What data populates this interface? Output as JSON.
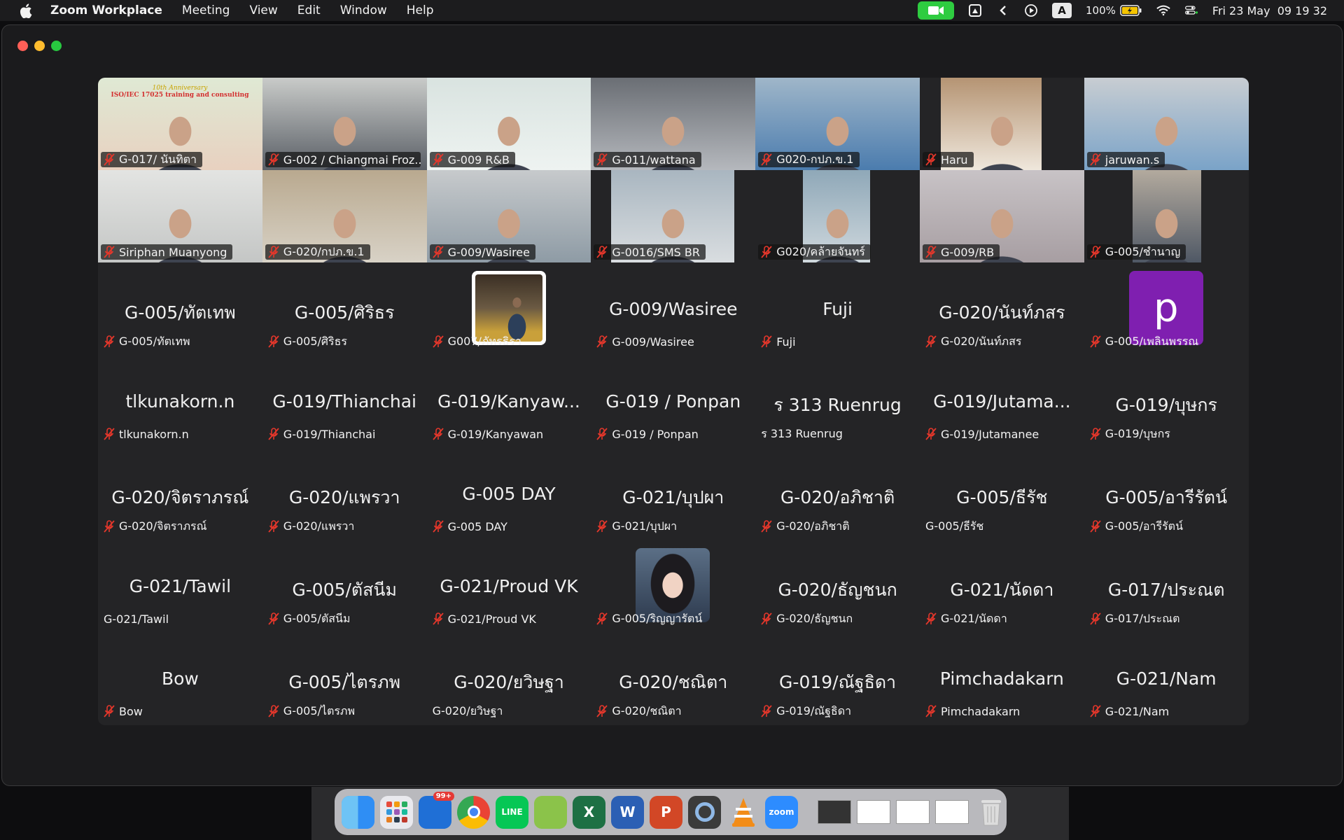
{
  "menubar": {
    "app_name": "Zoom Workplace",
    "items": [
      "Meeting",
      "View",
      "Edit",
      "Window",
      "Help"
    ],
    "keyboard_input": "A",
    "battery": "100%",
    "datetime": "Fri 23 May  09 19 32"
  },
  "gallery": {
    "video_tiles": [
      {
        "label": "G-017/ นันทิตา",
        "muted": true
      },
      {
        "label": "G-002 / Chiangmai Froz...",
        "muted": true
      },
      {
        "label": "G-009 R&B",
        "muted": true
      },
      {
        "label": "G-011/wattana",
        "muted": true
      },
      {
        "label": "G020-กปภ.ข.1",
        "muted": true
      },
      {
        "label": "Haru",
        "muted": true
      },
      {
        "label": "jaruwan.s",
        "muted": true
      },
      {
        "label": "Siriphan Muanyong",
        "muted": true
      },
      {
        "label": "G-020/กปภ.ข.1",
        "muted": true
      },
      {
        "label": "G-009/Wasiree",
        "muted": true
      },
      {
        "label": "G-0016/SMS BR",
        "muted": true
      },
      {
        "label": "G020/คล้ายจันทร์",
        "muted": true
      },
      {
        "label": "G-009/RB",
        "muted": true
      },
      {
        "label": "G-005/ชำนาญ",
        "muted": true
      }
    ],
    "video_banner": {
      "line1": "10th Anniversary",
      "line2": "ISO/IEC 17025 training and consulting"
    },
    "audio_rows": [
      [
        {
          "display": "G-005/ทัตเทพ",
          "label": "G-005/ทัตเทพ",
          "muted": true
        },
        {
          "display": "G-005/ศิริธร",
          "label": "G-005/ศิริธร",
          "muted": true
        },
        {
          "display": "",
          "label": "G007/ภัทรธิรา",
          "muted": true,
          "avatar": "photo"
        },
        {
          "display": "G-009/Wasiree",
          "label": "G-009/Wasiree",
          "muted": true
        },
        {
          "display": "Fuji",
          "label": "Fuji",
          "muted": true
        },
        {
          "display": "G-020/นันท์ภสร",
          "label": "G-020/นันท์ภสร",
          "muted": true
        },
        {
          "display": "",
          "label": "G-005/เพลินพรรณ",
          "muted": true,
          "avatar": "letter",
          "letter": "p"
        }
      ],
      [
        {
          "display": "tlkunakorn.n",
          "label": "tlkunakorn.n",
          "muted": true
        },
        {
          "display": "G-019/Thianchai",
          "label": "G-019/Thianchai",
          "muted": true
        },
        {
          "display": "G-019/Kanyaw...",
          "label": "G-019/Kanyawan",
          "muted": true
        },
        {
          "display": "G-019 / Ponpan",
          "label": "G-019 / Ponpan",
          "muted": true
        },
        {
          "display": "ร 313 Ruenrug",
          "label": "ร 313 Ruenrug",
          "muted": false
        },
        {
          "display": "G-019/Jutama...",
          "label": "G-019/Jutamanee",
          "muted": true
        },
        {
          "display": "G-019/บุษกร",
          "label": "G-019/บุษกร",
          "muted": true
        }
      ],
      [
        {
          "display": "G-020/จิตราภรณ์",
          "label": "G-020/จิตราภรณ์",
          "muted": true
        },
        {
          "display": "G-020/แพรวา",
          "label": "G-020/แพรวา",
          "muted": true
        },
        {
          "display": "G-005 DAY",
          "label": "G-005 DAY",
          "muted": true
        },
        {
          "display": "G-021/บุปผา",
          "label": "G-021/บุปผา",
          "muted": true
        },
        {
          "display": "G-020/อภิชาติ",
          "label": "G-020/อภิชาติ",
          "muted": true
        },
        {
          "display": "G-005/ธีรัช",
          "label": "G-005/ธีรัช",
          "muted": false
        },
        {
          "display": "G-005/อารีรัตน์",
          "label": "G-005/อารีรัตน์",
          "muted": true
        }
      ],
      [
        {
          "display": "G-021/Tawil",
          "label": "G-021/Tawil",
          "muted": false
        },
        {
          "display": "G-005/ตัสนีม",
          "label": "G-005/ตัสนีม",
          "muted": true
        },
        {
          "display": "G-021/Proud VK",
          "label": "G-021/Proud VK",
          "muted": true
        },
        {
          "display": "",
          "label": "G-005/ริญญารัตน์",
          "muted": true,
          "avatar": "photo2"
        },
        {
          "display": "G-020/ธัญชนก",
          "label": "G-020/ธัญชนก",
          "muted": true
        },
        {
          "display": "G-021/นัดดา",
          "label": "G-021/นัดดา",
          "muted": true
        },
        {
          "display": "G-017/ประณต",
          "label": "G-017/ประณต",
          "muted": true
        }
      ],
      [
        {
          "display": "Bow",
          "label": "Bow",
          "muted": true
        },
        {
          "display": "G-005/ไตรภพ",
          "label": "G-005/ไตรภพ",
          "muted": true
        },
        {
          "display": "G-020/ยวิษฐา",
          "label": "G-020/ยวิษฐา",
          "muted": false
        },
        {
          "display": "G-020/ชณิตา",
          "label": "G-020/ชณิตา",
          "muted": true
        },
        {
          "display": "G-019/ณัฐธิดา",
          "label": "G-019/ณัฐธิดา",
          "muted": true
        },
        {
          "display": "Pimchadakarn",
          "label": "Pimchadakarn",
          "muted": true
        },
        {
          "display": "G-021/Nam",
          "label": "G-021/Nam",
          "muted": true
        }
      ]
    ]
  },
  "dock": {
    "apps": [
      {
        "name": "finder-icon",
        "label": "",
        "color": "#2f8ef4"
      },
      {
        "name": "launchpad-icon",
        "label": "",
        "color": "#e9e9ee"
      },
      {
        "name": "thunderbird-icon",
        "label": "",
        "color": "#1f6fd6",
        "badge": "99+"
      },
      {
        "name": "chrome-icon",
        "label": "",
        "color": "#ffffff"
      },
      {
        "name": "line-icon",
        "label": "LINE",
        "color": "#06c755"
      },
      {
        "name": "notes-draw-icon",
        "label": "",
        "color": "#8bc34a"
      },
      {
        "name": "excel-icon",
        "label": "X",
        "color": "#1d7044"
      },
      {
        "name": "word-icon",
        "label": "W",
        "color": "#2b5fb4"
      },
      {
        "name": "powerpoint-icon",
        "label": "P",
        "color": "#d24726"
      },
      {
        "name": "quicktime-icon",
        "label": "",
        "color": "#3b3b3b"
      },
      {
        "name": "vlc-icon",
        "label": "",
        "color": "#f28c18"
      },
      {
        "name": "zoom-icon",
        "label": "zoom",
        "color": "#2d8cff"
      }
    ]
  },
  "colors": {
    "muted": "#e5372b",
    "avatar_letter_bg": "#7f1fb0",
    "accent_green": "#2ecc40"
  }
}
